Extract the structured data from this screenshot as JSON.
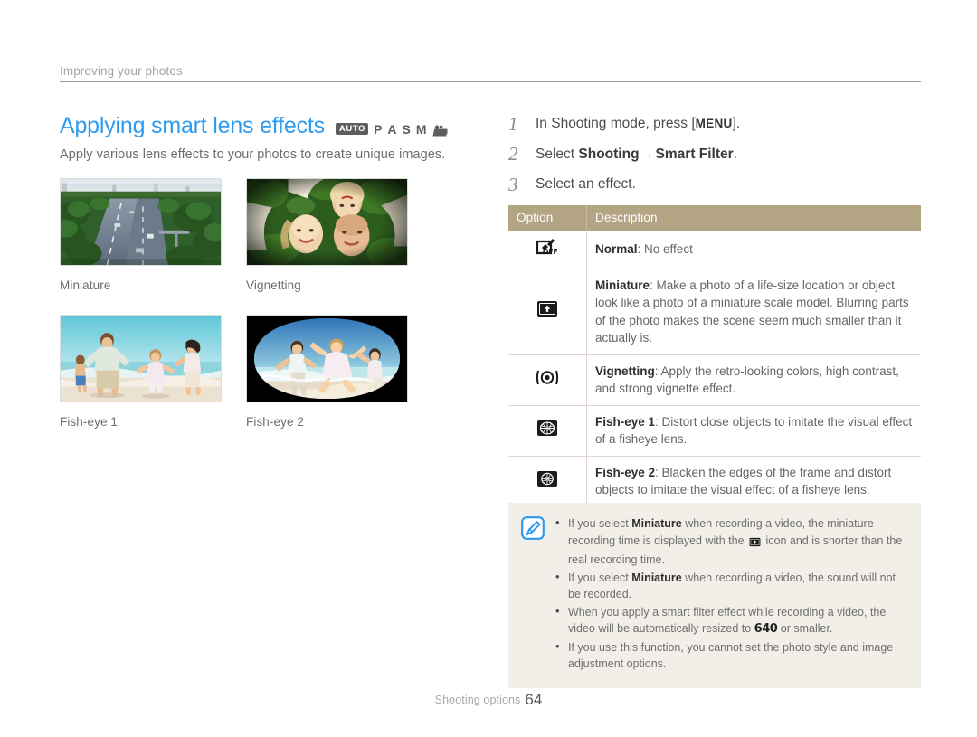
{
  "breadcrumb": {
    "label": "Improving your photos"
  },
  "header": {
    "title": "Applying smart lens effects",
    "subtitle": "Apply various lens effects to your photos to create unique images.",
    "modes": {
      "auto": "AUTO",
      "p": "P",
      "a": "A",
      "s": "S",
      "m": "M",
      "video_icon": "video-camera-icon"
    }
  },
  "samples": [
    {
      "caption": "Miniature",
      "icon": "sample-photo-miniature-highway"
    },
    {
      "caption": "Vignetting",
      "icon": "sample-photo-vignetting-faces"
    },
    {
      "caption": "Fish-eye 1",
      "icon": "sample-photo-fisheye1-beach-family"
    },
    {
      "caption": "Fish-eye 2",
      "icon": "sample-photo-fisheye2-beach-family"
    }
  ],
  "steps": [
    {
      "num": "1",
      "pre": "In Shooting mode, press [",
      "key": "MENU",
      "post": "]."
    },
    {
      "num": "2",
      "pre": "Select ",
      "bold1": "Shooting",
      "arrow": "→",
      "bold2": "Smart Filter",
      "post": "."
    },
    {
      "num": "3",
      "pre": "Select an effect.",
      "post": ""
    }
  ],
  "table": {
    "headers": {
      "option": "Option",
      "description": "Description"
    },
    "rows": [
      {
        "icon": "smart-filter-off-icon",
        "name": "Normal",
        "sep": ": ",
        "desc": "No effect"
      },
      {
        "icon": "smart-filter-miniature-icon",
        "name": "Miniature",
        "sep": ": ",
        "desc": "Make a photo of a life-size location or object look like a photo of a miniature scale model. Blurring parts of the photo makes the scene seem much smaller than it actually is."
      },
      {
        "icon": "smart-filter-vignetting-icon",
        "name": "Vignetting",
        "sep": ": ",
        "desc": "Apply the retro-looking colors, high contrast, and strong vignette effect."
      },
      {
        "icon": "smart-filter-fisheye1-icon",
        "name": "Fish-eye 1",
        "sep": ": ",
        "desc": "Distort close objects to imitate the visual effect of a fisheye lens."
      },
      {
        "icon": "smart-filter-fisheye2-icon",
        "name": "Fish-eye 2",
        "sep": ": ",
        "desc": "Blacken the edges of the frame and distort objects to imitate the visual effect of a fisheye lens."
      }
    ]
  },
  "note": {
    "icon": "note-pen-icon",
    "items": [
      {
        "p1": "If you select ",
        "b1": "Miniature",
        "p2": " when recording a video, the miniature recording time is displayed with the ",
        "inline_icon": "miniature-icon",
        "p3": " icon and is shorter than the real recording time."
      },
      {
        "p1": "If you select ",
        "b1": "Miniature",
        "p2": " when recording a video, the sound will not be recorded.",
        "p3": ""
      },
      {
        "p1": "When you apply a smart filter effect while recording a video, the video will be automatically resized to ",
        "chip": "640",
        "p3": " or smaller."
      },
      {
        "p1": "If you use this function, you cannot set the photo style and image adjustment options.",
        "p3": ""
      }
    ]
  },
  "footer": {
    "label": "Shooting options",
    "page": "64"
  },
  "colors": {
    "title_blue": "#2e9bef",
    "table_header": "#b3a484",
    "note_bg": "#f2efe8",
    "body_text": "#666666"
  }
}
